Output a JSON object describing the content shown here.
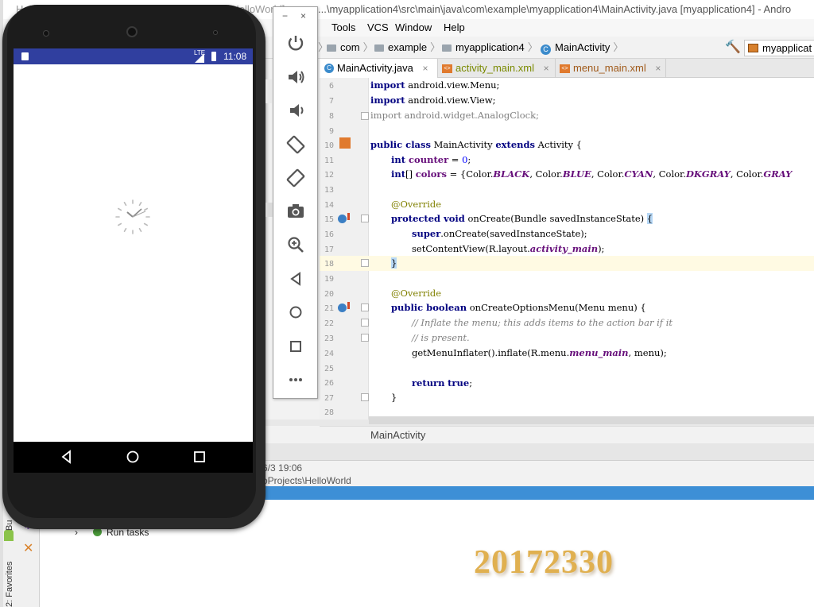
{
  "titlebar": {
    "left_fragment": "HelloWorld [C:\\Users\\...\\AndroidStudioProjects\\HelloWorld]",
    "title": "...\\myapplication4\\src\\main\\java\\com\\example\\myapplication4\\MainActivity.java [myapplication4] - Andro"
  },
  "menu": {
    "fragment": "n",
    "tools": "Tools",
    "vcs": "VCS",
    "window": "Window",
    "help": "Help"
  },
  "breadcrumbs": {
    "com": "com",
    "example": "example",
    "module": "myapplication4",
    "cls": "MainActivity"
  },
  "run_config": "myapplicat",
  "tabs": [
    {
      "label": "MainActivity.java",
      "icon": "class-icon",
      "close": "×"
    },
    {
      "label": "activity_main.xml",
      "icon": "xml-icon",
      "close": "×"
    },
    {
      "label": "menu_main.xml",
      "icon": "xml-icon",
      "close": "×"
    }
  ],
  "code": {
    "line_numbers": [
      "6",
      "7",
      "8",
      "9",
      "10",
      "11",
      "12",
      "13",
      "14",
      "15",
      "16",
      "17",
      "18",
      "19",
      "20",
      "21",
      "22",
      "23",
      "24",
      "25",
      "26",
      "27",
      "28"
    ],
    "l5_kw": "import",
    "l5_rest": " android.view.Menu;",
    "l6_kw": "import",
    "l6_rest": " android.view.View;",
    "l7_kw": "import",
    "l7_rest": " android.widget.AnalogClock;",
    "l9_kw1": "public class",
    "l9_mid": " MainActivity ",
    "l9_kw2": "extends",
    "l9_rest": " Activity {",
    "l10_kw": "int",
    "l10_fld": " counter",
    "l10_mid": " = ",
    "l10_num": "0",
    "l10_end": ";",
    "l11_kw": "int",
    "l11_a": "[] ",
    "l11_fld": "colors",
    "l11_b": " = {Color.",
    "l11_c1": "BLACK",
    "l11_s1": ", Color.",
    "l11_c2": "BLUE",
    "l11_s2": ", Color.",
    "l11_c3": "CYAN",
    "l11_s3": ", Color.",
    "l11_c4": "DKGRAY",
    "l11_s4": ", Color.",
    "l11_c5": "GRAY",
    "l13_ann": "@Override",
    "l14_kw": "protected void",
    "l14_rest": " onCreate(Bundle savedInstanceState) ",
    "l14_brace": "{",
    "l15_kw": "super",
    "l15_rest": ".onCreate(savedInstanceState);",
    "l16_a": "setContentView(R.layout.",
    "l16_fld": "activity_main",
    "l16_b": ");",
    "l17_brace": "}",
    "l19_ann": "@Override",
    "l20_kw": "public boolean",
    "l20_rest": " onCreateOptionsMenu(Menu menu) {",
    "l21_cmt": "// Inflate the menu; this adds items to the action bar if it",
    "l22_cmt": "// is present.",
    "l23_a": "getMenuInflater().inflate(R.menu.",
    "l23_fld": "menu_main",
    "l23_b": ", menu);",
    "l25_kw": "return",
    "l25_mid": " ",
    "l25_kw2": "true",
    "l25_end": ";",
    "l26_brace": "}"
  },
  "editor_breadcrumb": "MainActivity",
  "bottom_panel": {
    "timestamp": "6/3 19:06",
    "path": "oProjects\\HelloWorld",
    "run_tasks": "Run tasks",
    "build_tab": "Bu",
    "favorites_tab": "2: Favorites"
  },
  "watermark": "20172330",
  "emulator": {
    "window_minimize": "−",
    "window_close": "×",
    "tools": [
      "power-icon",
      "volume-up-icon",
      "volume-down-icon",
      "rotate-left-icon",
      "rotate-right-icon",
      "camera-icon",
      "zoom-icon",
      "back-icon",
      "home-icon",
      "overview-icon",
      "more-icon"
    ],
    "status_time": "11:08",
    "status_lte": "LTE"
  },
  "colors": {
    "status_bar": "#303f9f",
    "accent_blue": "#3d8fd6",
    "keyword": "#000080",
    "field": "#660e7a",
    "watermark": "#e0b050"
  }
}
